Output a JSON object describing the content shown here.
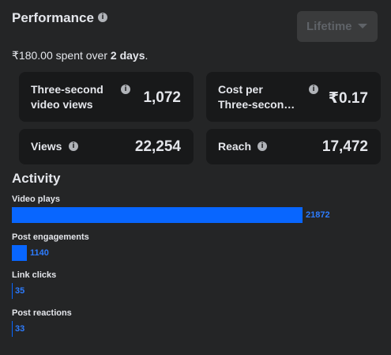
{
  "header": {
    "title": "Performance",
    "dropdown": "Lifetime"
  },
  "summary": {
    "amount": "₹180.00",
    "spent_over": " spent over ",
    "days": "2 days",
    "period": "."
  },
  "metrics": {
    "three_second": {
      "label_line1": "Three-second",
      "label_line2": "video views",
      "value": "1,072"
    },
    "cost_per": {
      "label_line1": "Cost per",
      "label_line2": "Three-secon…",
      "value": "₹0.17"
    },
    "views": {
      "label": "Views",
      "value": "22,254"
    },
    "reach": {
      "label": "Reach",
      "value": "17,472"
    }
  },
  "activity": {
    "title": "Activity",
    "items": [
      {
        "label": "Video plays",
        "value": "21872"
      },
      {
        "label": "Post engagements",
        "value": "1140"
      },
      {
        "label": "Link clicks",
        "value": "35"
      },
      {
        "label": "Post reactions",
        "value": "33"
      }
    ]
  },
  "colors": {
    "background": "#242526",
    "card": "#18191a",
    "accent": "#0866ff"
  },
  "icons": [
    "info-icon",
    "chevron-down-icon"
  ]
}
